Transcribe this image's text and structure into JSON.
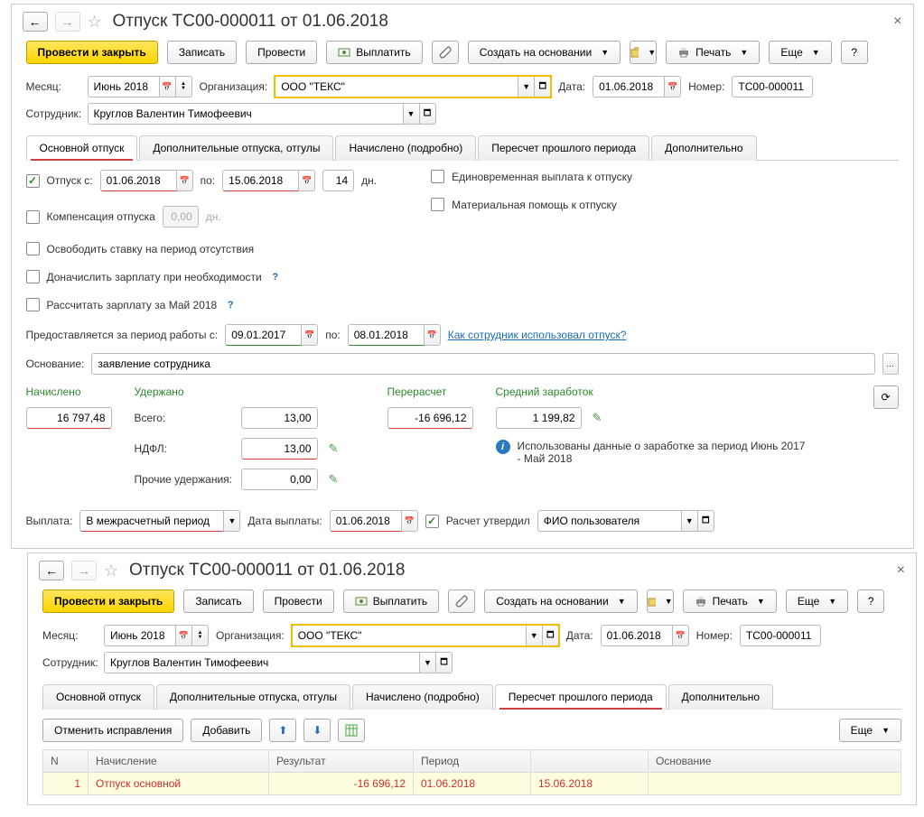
{
  "win1": {
    "title": "Отпуск ТС00-000011 от 01.06.2018",
    "toolbar": {
      "post_close": "Провести и закрыть",
      "save": "Записать",
      "post": "Провести",
      "pay": "Выплатить",
      "create_based": "Создать на основании",
      "print": "Печать",
      "more": "Еще",
      "help": "?"
    },
    "fields": {
      "month_label": "Месяц:",
      "month": "Июнь 2018",
      "org_label": "Организация:",
      "org": "ООО \"ТЕКС\"",
      "date_label": "Дата:",
      "date": "01.06.2018",
      "number_label": "Номер:",
      "number": "ТС00-000011",
      "employee_label": "Сотрудник:",
      "employee": "Круглов Валентин Тимофеевич"
    },
    "tabs": [
      "Основной отпуск",
      "Дополнительные отпуска, отгулы",
      "Начислено (подробно)",
      "Пересчет прошлого периода",
      "Дополнительно"
    ],
    "main": {
      "vacation_label": "Отпуск  с:",
      "from": "01.06.2018",
      "to_label": "по:",
      "to": "15.06.2018",
      "days": "14",
      "days_label": "дн.",
      "lump_label": "Единовременная выплата к отпуску",
      "mat_label": "Материальная помощь к отпуску",
      "comp_label": "Компенсация отпуска",
      "comp_days": "0,00",
      "comp_days_label": "дн.",
      "free_label": "Освободить ставку на период отсутствия",
      "accrue_label": "Доначислить зарплату при необходимости",
      "recalc_label": "Рассчитать зарплату за Май 2018",
      "period_label": "Предоставляется за период работы с:",
      "period_from": "09.01.2017",
      "period_to_label": "по:",
      "period_to": "08.01.2018",
      "how_link": "Как сотрудник использовал отпуск?",
      "basis_label": "Основание:",
      "basis": "заявление сотрудника"
    },
    "summary": {
      "accrued_label": "Начислено",
      "accrued": "16 797,48",
      "withheld_label": "Удержано",
      "total_label": "Всего:",
      "total": "13,00",
      "ndfl_label": "НДФЛ:",
      "ndfl": "13,00",
      "other_label": "Прочие удержания:",
      "other": "0,00",
      "recalc_label": "Перерасчет",
      "recalc": "-16 696,12",
      "avg_label": "Средний заработок",
      "avg": "1 199,82",
      "info_text": "Использованы данные о заработке за период Июнь 2017 - Май 2018"
    },
    "payout": {
      "label": "Выплата:",
      "when": "В межрасчетный период",
      "date_label": "Дата выплаты:",
      "date": "01.06.2018",
      "approved_label": "Расчет утвердил",
      "approved_by": "ФИО пользователя"
    }
  },
  "win2": {
    "title": "Отпуск ТС00-000011 от 01.06.2018",
    "toolbar": {
      "post_close": "Провести и закрыть",
      "save": "Записать",
      "post": "Провести",
      "pay": "Выплатить",
      "create_based": "Создать на основании",
      "print": "Печать",
      "more": "Еще",
      "help": "?"
    },
    "fields": {
      "month_label": "Месяц:",
      "month": "Июнь 2018",
      "org_label": "Организация:",
      "org": "ООО \"ТЕКС\"",
      "date_label": "Дата:",
      "date": "01.06.2018",
      "number_label": "Номер:",
      "number": "ТС00-000011",
      "employee_label": "Сотрудник:",
      "employee": "Круглов Валентин Тимофеевич"
    },
    "tabs": [
      "Основной отпуск",
      "Дополнительные отпуска, отгулы",
      "Начислено (подробно)",
      "Пересчет прошлого периода",
      "Дополнительно"
    ],
    "recalc": {
      "cancel": "Отменить исправления",
      "add": "Добавить",
      "more": "Еще",
      "columns": [
        "N",
        "Начисление",
        "Результат",
        "Период",
        "",
        "Основание"
      ],
      "row": {
        "n": "1",
        "name": "Отпуск основной",
        "result": "-16 696,12",
        "p_from": "01.06.2018",
        "p_to": "15.06.2018",
        "basis": ""
      }
    }
  }
}
